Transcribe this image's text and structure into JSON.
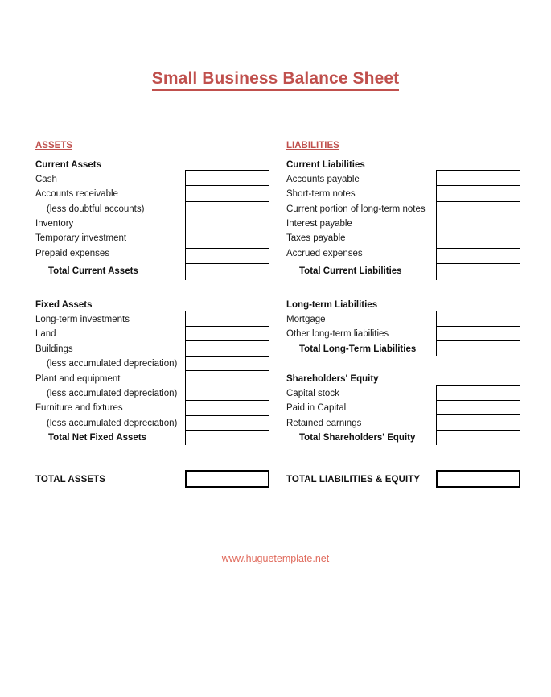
{
  "document": {
    "title": "Small Business Balance Sheet",
    "footer_url": "www.huguetemplate.net",
    "title_color": "#C0504D",
    "footer_color": "#E06A5C",
    "border_color": "#000000",
    "background_color": "#FFFFFF"
  },
  "left_column": {
    "section_title": "ASSETS",
    "groups": [
      {
        "heading": "Current Assets",
        "rows": [
          {
            "label": "Cash",
            "style": "normal",
            "value": ""
          },
          {
            "label": "Accounts receivable",
            "style": "normal",
            "value": ""
          },
          {
            "label": "(less doubtful accounts)",
            "style": "indent",
            "value": ""
          },
          {
            "label": "Inventory",
            "style": "normal",
            "value": ""
          },
          {
            "label": "Temporary investment",
            "style": "normal",
            "value": ""
          },
          {
            "label": "Prepaid expenses",
            "style": "normal",
            "value": ""
          },
          {
            "label": "Total Current Assets",
            "style": "total",
            "value": ""
          }
        ]
      },
      {
        "heading": "Fixed Assets",
        "rows": [
          {
            "label": "Long-term investments",
            "style": "normal",
            "value": ""
          },
          {
            "label": "Land",
            "style": "normal",
            "value": ""
          },
          {
            "label": "Buildings",
            "style": "normal",
            "value": ""
          },
          {
            "label": "(less accumulated depreciation)",
            "style": "indent",
            "value": ""
          },
          {
            "label": "Plant and equipment",
            "style": "normal",
            "value": ""
          },
          {
            "label": "(less accumulated depreciation)",
            "style": "indent",
            "value": ""
          },
          {
            "label": "Furniture and fixtures",
            "style": "normal",
            "value": ""
          },
          {
            "label": "(less accumulated depreciation)",
            "style": "indent",
            "value": ""
          },
          {
            "label": "Total Net Fixed Assets",
            "style": "total",
            "value": ""
          }
        ]
      }
    ],
    "grand_total": {
      "label": "TOTAL ASSETS",
      "value": ""
    }
  },
  "right_column": {
    "section_title": "LIABILITIES",
    "groups": [
      {
        "heading": "Current Liabilities",
        "rows": [
          {
            "label": "Accounts payable",
            "style": "normal",
            "value": ""
          },
          {
            "label": "Short-term notes",
            "style": "normal",
            "value": ""
          },
          {
            "label": "Current portion of long-term notes",
            "style": "normal",
            "value": ""
          },
          {
            "label": "Interest payable",
            "style": "normal",
            "value": ""
          },
          {
            "label": "Taxes payable",
            "style": "normal",
            "value": ""
          },
          {
            "label": "Accrued expenses",
            "style": "normal",
            "value": ""
          },
          {
            "label": "Total Current Liabilities",
            "style": "total",
            "value": ""
          }
        ]
      },
      {
        "heading": "Long-term Liabilities",
        "rows": [
          {
            "label": "Mortgage",
            "style": "normal",
            "value": ""
          },
          {
            "label": "Other long-term liabilities",
            "style": "normal",
            "value": ""
          },
          {
            "label": "Total Long-Term Liabilities",
            "style": "total",
            "value": ""
          }
        ]
      },
      {
        "heading": "Shareholders' Equity",
        "rows": [
          {
            "label": "Capital stock",
            "style": "normal",
            "value": ""
          },
          {
            "label": "Paid in Capital",
            "style": "normal",
            "value": ""
          },
          {
            "label": "Retained earnings",
            "style": "normal",
            "value": ""
          },
          {
            "label": "Total Shareholders' Equity",
            "style": "total",
            "value": ""
          }
        ]
      }
    ],
    "grand_total": {
      "label": "TOTAL LIABILITIES & EQUITY",
      "value": ""
    }
  }
}
